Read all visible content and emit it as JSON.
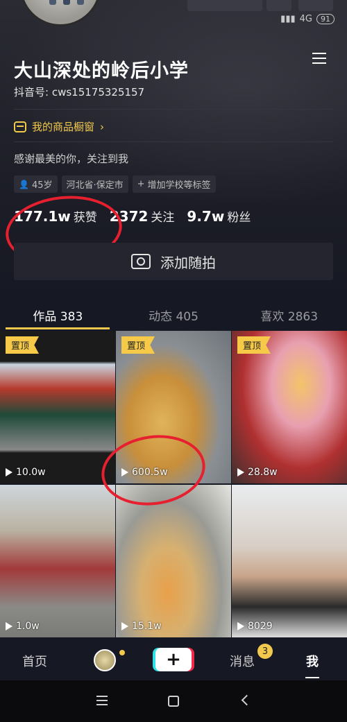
{
  "status": {
    "network": "4G",
    "battery": "91"
  },
  "profile": {
    "name": "大山深处的岭后小学",
    "douyin_id": "抖音号: cws15175325157",
    "shop_label": "我的商品橱窗",
    "bio": "感谢最美的你，关注到我",
    "tags": {
      "age": "45岁",
      "location": "河北省·保定市",
      "add_tag": "增加学校等标签"
    }
  },
  "stats": {
    "likes_value": "177.1w",
    "likes_label": "获赞",
    "following_value": "2372",
    "following_label": "关注",
    "fans_value": "9.7w",
    "fans_label": "粉丝"
  },
  "add_moment_label": "添加随拍",
  "tabs": [
    {
      "label": "作品 383"
    },
    {
      "label": "动态 405"
    },
    {
      "label": "喜欢 2863"
    }
  ],
  "pin_label": "置顶",
  "videos": [
    {
      "plays": "10.0w",
      "pinned": true
    },
    {
      "plays": "600.5w",
      "pinned": true
    },
    {
      "plays": "28.8w",
      "pinned": true
    },
    {
      "plays": "1.0w",
      "pinned": false
    },
    {
      "plays": "15.1w",
      "pinned": false
    },
    {
      "plays": "8029",
      "pinned": false
    }
  ],
  "nav": {
    "home": "首页",
    "messages": "消息",
    "messages_badge": "3",
    "me": "我",
    "plus": "+"
  },
  "colors": {
    "background": "#161823",
    "accent": "#f2c94c",
    "annotation": "#e6202e"
  }
}
